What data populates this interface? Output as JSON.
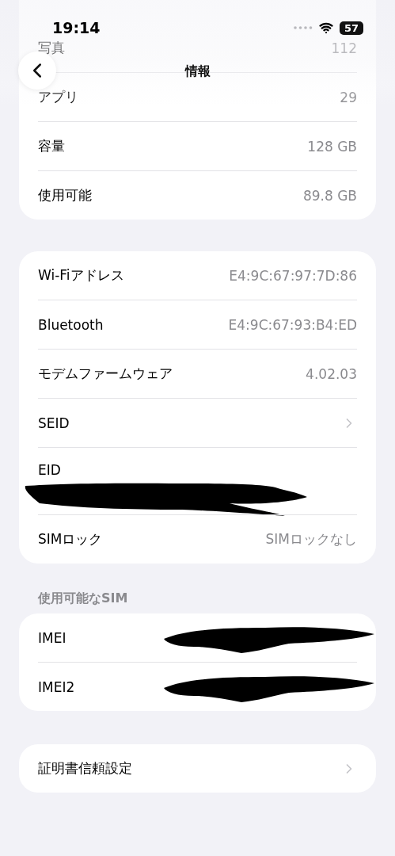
{
  "status_bar": {
    "time": "19:14",
    "battery": "57"
  },
  "nav": {
    "title": "情報"
  },
  "sections": [
    {
      "rows": [
        {
          "kind": "value",
          "label": "写真",
          "value": "112"
        },
        {
          "kind": "value",
          "label": "アプリ",
          "value": "29"
        },
        {
          "kind": "value",
          "label": "容量",
          "value": "128 GB"
        },
        {
          "kind": "value",
          "label": "使用可能",
          "value": "89.8 GB"
        }
      ]
    },
    {
      "rows": [
        {
          "kind": "value",
          "label": "Wi-Fiアドレス",
          "value": "E4:9C:67:97:7D:86"
        },
        {
          "kind": "value",
          "label": "Bluetooth",
          "value": "E4:9C:67:93:B4:ED"
        },
        {
          "kind": "value",
          "label": "モデムファームウェア",
          "value": "4.02.03"
        },
        {
          "kind": "link",
          "label": "SEID"
        },
        {
          "kind": "stacked",
          "label": "EID"
        },
        {
          "kind": "value",
          "label": "SIMロック",
          "value": "SIMロックなし"
        }
      ]
    },
    {
      "header": "使用可能なSIM",
      "rows": [
        {
          "kind": "masked",
          "label": "IMEI"
        },
        {
          "kind": "masked",
          "label": "IMEI2"
        }
      ]
    },
    {
      "rows": [
        {
          "kind": "link",
          "label": "証明書信頼設定"
        }
      ]
    }
  ]
}
